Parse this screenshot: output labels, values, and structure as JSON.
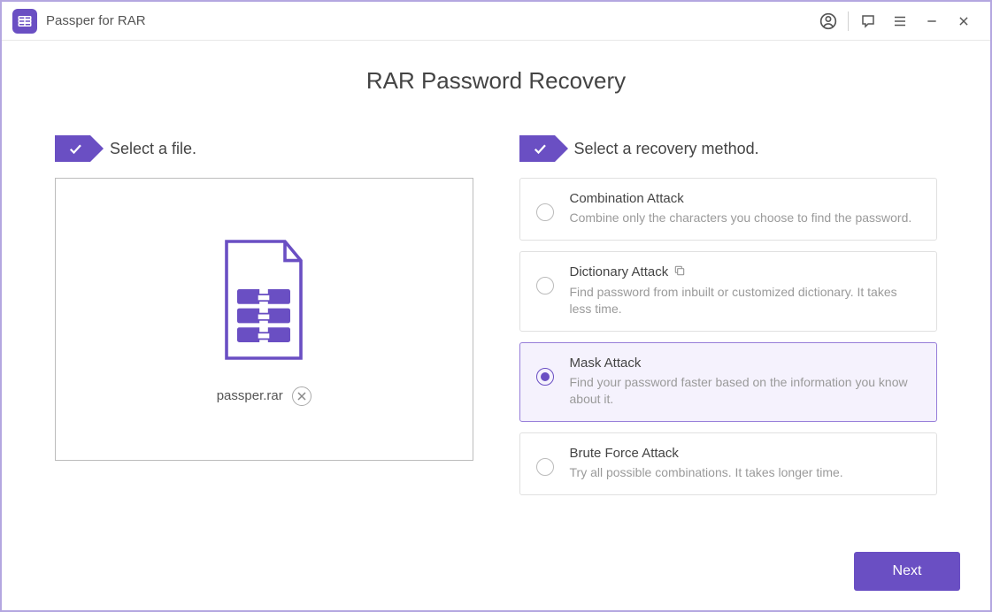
{
  "app": {
    "title": "Passper for RAR"
  },
  "page": {
    "title": "RAR Password Recovery"
  },
  "steps": {
    "file": {
      "label": "Select a file."
    },
    "method": {
      "label": "Select a recovery method."
    }
  },
  "file": {
    "name": "passper.rar"
  },
  "methods": [
    {
      "title": "Combination Attack",
      "desc": "Combine only the characters you choose to find the password.",
      "selected": false,
      "hasCopy": false
    },
    {
      "title": "Dictionary Attack",
      "desc": "Find password from inbuilt or customized dictionary. It takes less time.",
      "selected": false,
      "hasCopy": true
    },
    {
      "title": "Mask Attack",
      "desc": "Find your password faster based on the information you know about it.",
      "selected": true,
      "hasCopy": false
    },
    {
      "title": "Brute Force Attack",
      "desc": "Try all possible combinations. It takes longer time.",
      "selected": false,
      "hasCopy": false
    }
  ],
  "buttons": {
    "next": "Next"
  }
}
